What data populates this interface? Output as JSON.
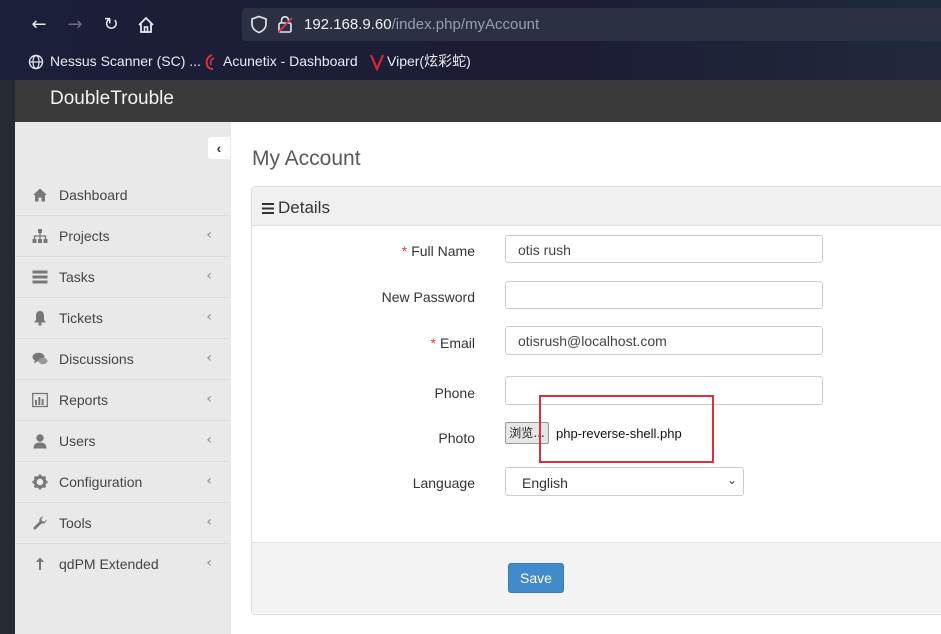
{
  "browser": {
    "url_host": "192.168.9.60",
    "url_path": "/index.php/myAccount",
    "bookmarks": [
      {
        "label": "Nessus Scanner (SC) ...",
        "icon": "globe-icon"
      },
      {
        "label": "Acunetix - Dashboard",
        "icon": "acunetix-icon"
      },
      {
        "label": "Viper(炫彩蛇)",
        "icon": "viper-icon"
      }
    ]
  },
  "app": {
    "brand": "DoubleTrouble"
  },
  "sidebar": {
    "items": [
      {
        "label": "Dashboard",
        "icon": "home-icon",
        "has_chevron": false
      },
      {
        "label": "Projects",
        "icon": "sitemap-icon",
        "has_chevron": true
      },
      {
        "label": "Tasks",
        "icon": "tasks-icon",
        "has_chevron": true
      },
      {
        "label": "Tickets",
        "icon": "bell-icon",
        "has_chevron": true
      },
      {
        "label": "Discussions",
        "icon": "comments-icon",
        "has_chevron": true
      },
      {
        "label": "Reports",
        "icon": "bar-chart-icon",
        "has_chevron": true
      },
      {
        "label": "Users",
        "icon": "user-icon",
        "has_chevron": true
      },
      {
        "label": "Configuration",
        "icon": "gear-icon",
        "has_chevron": true
      },
      {
        "label": "Tools",
        "icon": "wrench-icon",
        "has_chevron": true
      },
      {
        "label": "qdPM Extended",
        "icon": "upload-icon",
        "has_chevron": true
      }
    ]
  },
  "page": {
    "title": "My Account",
    "panel_title": "Details"
  },
  "form": {
    "full_name": {
      "label": "Full Name",
      "required": "*",
      "value": "otis rush"
    },
    "new_password": {
      "label": "New Password",
      "value": ""
    },
    "email": {
      "label": "Email",
      "required": "*",
      "value": "otisrush@localhost.com"
    },
    "phone": {
      "label": "Phone",
      "value": ""
    },
    "photo": {
      "label": "Photo",
      "browse_label": "浏览...",
      "file_name": "php-reverse-shell.php"
    },
    "language": {
      "label": "Language",
      "value": "English"
    },
    "save_label": "Save"
  },
  "colors": {
    "accent": "#428bca",
    "highlight_box": "#d9303a"
  }
}
